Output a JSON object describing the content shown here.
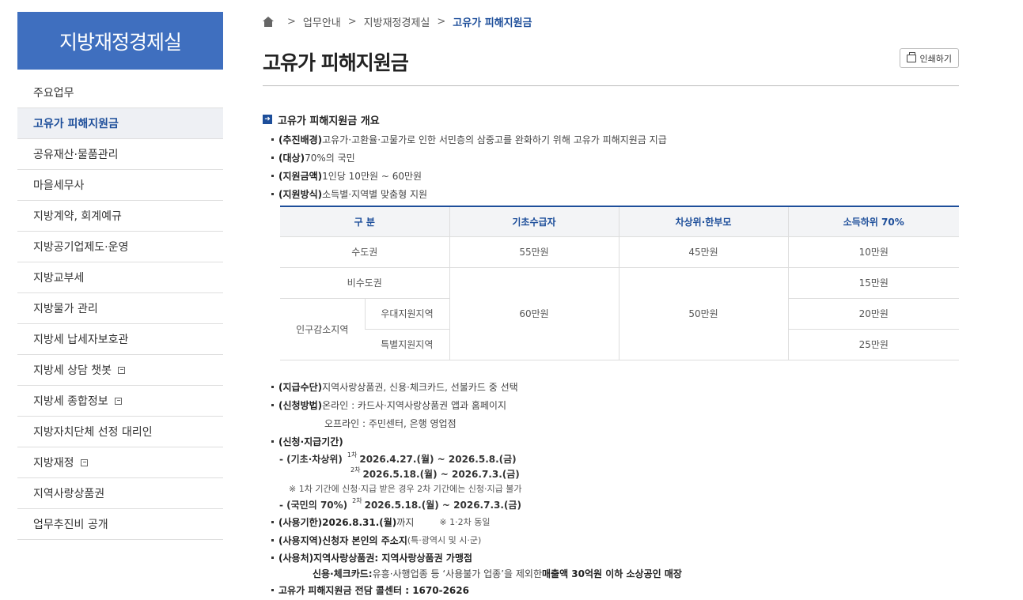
{
  "sidebar": {
    "title": "지방재정경제실",
    "items": [
      {
        "label": "주요업무",
        "active": false,
        "external": false
      },
      {
        "label": "고유가 피해지원금",
        "active": true,
        "external": false
      },
      {
        "label": "공유재산·물품관리",
        "active": false,
        "external": false
      },
      {
        "label": "마을세무사",
        "active": false,
        "external": false
      },
      {
        "label": "지방계약, 회계예규",
        "active": false,
        "external": false
      },
      {
        "label": "지방공기업제도·운영",
        "active": false,
        "external": false
      },
      {
        "label": "지방교부세",
        "active": false,
        "external": false
      },
      {
        "label": "지방물가 관리",
        "active": false,
        "external": false
      },
      {
        "label": "지방세 납세자보호관",
        "active": false,
        "external": false
      },
      {
        "label": "지방세 상담 챗봇",
        "active": false,
        "external": true
      },
      {
        "label": "지방세 종합정보",
        "active": false,
        "external": true
      },
      {
        "label": "지방자치단체 선정 대리인",
        "active": false,
        "external": false
      },
      {
        "label": "지방재정",
        "active": false,
        "external": true
      },
      {
        "label": "지역사랑상품권",
        "active": false,
        "external": false
      },
      {
        "label": "업무추진비 공개",
        "active": false,
        "external": false
      }
    ]
  },
  "breadcrumb": {
    "sep": ">",
    "items": [
      "업무안내",
      "지방재정경제실",
      "고유가 피해지원금"
    ]
  },
  "page": {
    "title": "고유가 피해지원금",
    "print_label": "인쇄하기"
  },
  "section": {
    "title": "고유가 피해지원금 개요"
  },
  "overview": {
    "bg_label": "(추진배경)",
    "bg_text": " 고유가·고환율·고물가로 인한 서민층의 삼중고를 완화하기 위해 고유가 피해지원금 지급",
    "target_label": "(대상)",
    "target_text": " 70%의 국민",
    "amount_label": "(지원금액)",
    "amount_text": " 1인당 10만원 ~ 60만원",
    "method_label": "(지원방식)",
    "method_text": " 소득별·지역별 맞춤형 지원"
  },
  "table": {
    "headers": [
      "구  분",
      "기초수급자",
      "차상위·한부모",
      "소득하위 70%"
    ],
    "r1": [
      "수도권",
      "55만원",
      "45만원",
      "10만원"
    ],
    "r2_label": "비수도권",
    "r2_last": "15만원",
    "merged_basic": "60만원",
    "merged_near": "50만원",
    "pop_label": "인구감소지역",
    "r3_sub": "우대지원지역",
    "r3_last": "20만원",
    "r4_sub": "특별지원지역",
    "r4_last": "25만원"
  },
  "details": {
    "means_label": "(지급수단)",
    "means_text": " 지역사랑상품권, 신용·체크카드, 선불카드 중 선택",
    "apply_label": "(신청방법)",
    "apply_online": " 온라인 : 카드사·지역사랑상품권 앱과 홈페이지",
    "apply_offline": "오프라인 : 주민센터, 은행 영업점",
    "period_label": "(신청·지급기간)",
    "p1_label": "- (기초·차상위)",
    "p1_sup1": "1차",
    "p1_date1": "2026.4.27.(월) ~ 2026.5.8.(금)",
    "p1_sup2": "2차",
    "p1_date2": "2026.5.18.(월) ~ 2026.7.3.(금)",
    "p1_note": "※ 1차 기간에 신청·지급 받은 경우 2차 기간에는 신청·지급 불가",
    "p2_label": "- (국민의 70%)",
    "p2_sup": "2차",
    "p2_date": "2026.5.18.(월) ~ 2026.7.3.(금)",
    "use_label": "(사용기한)",
    "use_date": " 2026.8.31.(월)",
    "use_suffix": " 까지",
    "use_note": "※ 1·2차 동일",
    "area_label": "(사용지역)",
    "area_bold": " 신청자 본인의 주소지",
    "area_note": "(특·광역시 및 시·군)",
    "where_label": "(사용처)",
    "where_bold": " 지역사랑상품권: 지역사랑상품권 가맹점",
    "card_label": "신용·체크카드:",
    "card_text": " 유흥·사행업종 등 ‘사용불가 업종’을 제외한 ",
    "card_bold": "매출액 30억원 이하 소상공인 매장",
    "call_text": "고유가 피해지원금 전담 콜센터 : 1670-2626"
  }
}
